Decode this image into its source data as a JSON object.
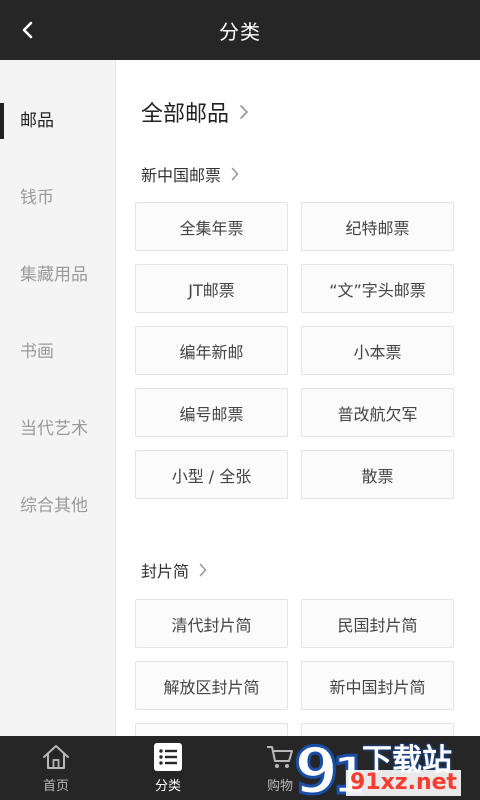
{
  "header": {
    "title": "分类"
  },
  "sidebar": {
    "items": [
      {
        "label": "邮品",
        "active": true
      },
      {
        "label": "钱币",
        "active": false
      },
      {
        "label": "集藏用品",
        "active": false
      },
      {
        "label": "书画",
        "active": false
      },
      {
        "label": "当代艺术",
        "active": false
      },
      {
        "label": "综合其他",
        "active": false
      }
    ]
  },
  "content": {
    "all_title": "全部邮品",
    "sections": [
      {
        "title": "新中国邮票",
        "items": [
          "全集年票",
          "纪特邮票",
          "JT邮票",
          "“文”字头邮票",
          "编年新邮",
          "小本票",
          "编号邮票",
          "普改航欠军",
          "小型 / 全张",
          "散票"
        ]
      },
      {
        "title": "封片简",
        "items": [
          "清代封片简",
          "民国封片简",
          "解放区封片简",
          "新中国封片简"
        ]
      }
    ]
  },
  "tabbar": {
    "tabs": [
      {
        "label": "首页",
        "icon": "home-icon",
        "active": false
      },
      {
        "label": "分类",
        "icon": "list-icon",
        "active": true
      },
      {
        "label": "购物",
        "icon": "cart-icon",
        "active": false
      }
    ]
  },
  "watermark": {
    "top": "下载站",
    "bottom": "91xz.net"
  },
  "colors": {
    "header_bg": "#262626",
    "tabbar_bg": "#262626",
    "active_text": "#222222",
    "watermark_red": "#ff3b30"
  }
}
